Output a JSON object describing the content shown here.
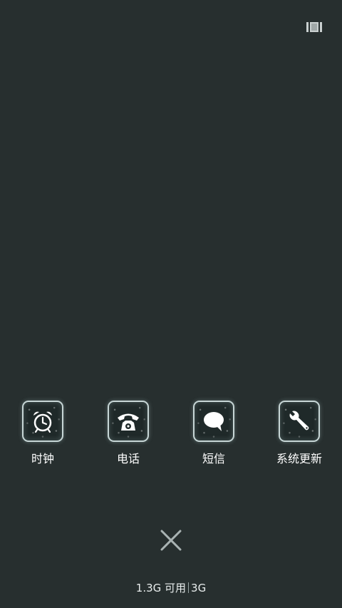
{
  "header": {
    "menu_icon": "recent-apps-icon"
  },
  "apps": [
    {
      "label": "时钟",
      "icon": "alarm-clock-icon"
    },
    {
      "label": "电话",
      "icon": "telephone-icon"
    },
    {
      "label": "短信",
      "icon": "message-bubble-icon"
    },
    {
      "label": "系统更新",
      "icon": "wrench-icon"
    }
  ],
  "close": {
    "icon": "close-icon"
  },
  "status": {
    "memory": "1.3G 可用",
    "network": "3G"
  },
  "colors": {
    "background": "#272f2f",
    "tile_border": "#c7d6d6",
    "text": "#ffffff"
  }
}
